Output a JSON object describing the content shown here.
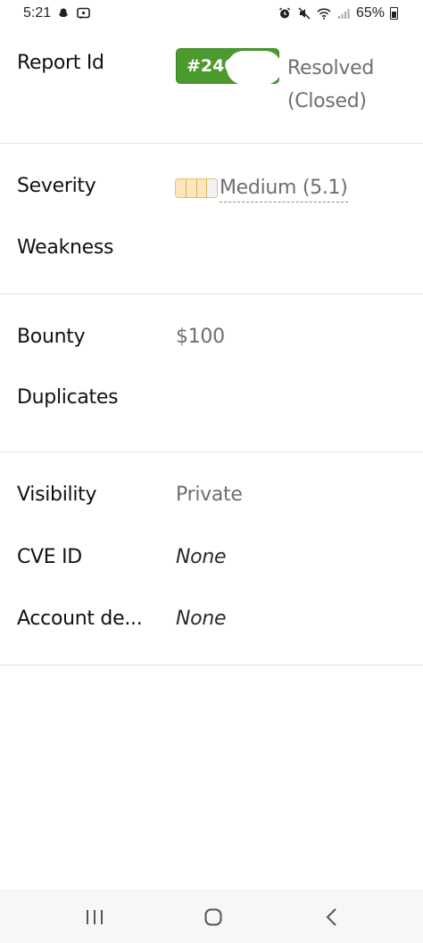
{
  "status_bar": {
    "time": "5:21",
    "battery_percent": "65%",
    "left_icons": [
      "snapchat-icon",
      "message-icon"
    ],
    "right_icons": [
      "alarm-icon",
      "mute-icon",
      "wifi-icon",
      "signal-icon",
      "battery-icon"
    ]
  },
  "report": {
    "id_label": "Report Id",
    "id_badge": "#240",
    "status_line1": "Resolved",
    "status_line2": "(Closed)",
    "badge_color": "#4a9a2e"
  },
  "severity": {
    "label": "Severity",
    "value": "Medium (5.1)",
    "segments_total": 4,
    "segments_filled": 3,
    "meter_color": "#e8c06a"
  },
  "weakness": {
    "label": "Weakness",
    "value": ""
  },
  "bounty": {
    "label": "Bounty",
    "value": "$100"
  },
  "duplicates": {
    "label": "Duplicates",
    "value": ""
  },
  "visibility": {
    "label": "Visibility",
    "value": "Private"
  },
  "cve": {
    "label": "CVE ID",
    "value": "None"
  },
  "account": {
    "label": "Account de...",
    "value": "None"
  },
  "nav": {
    "buttons": [
      "recent-apps-icon",
      "home-icon",
      "back-icon"
    ]
  }
}
